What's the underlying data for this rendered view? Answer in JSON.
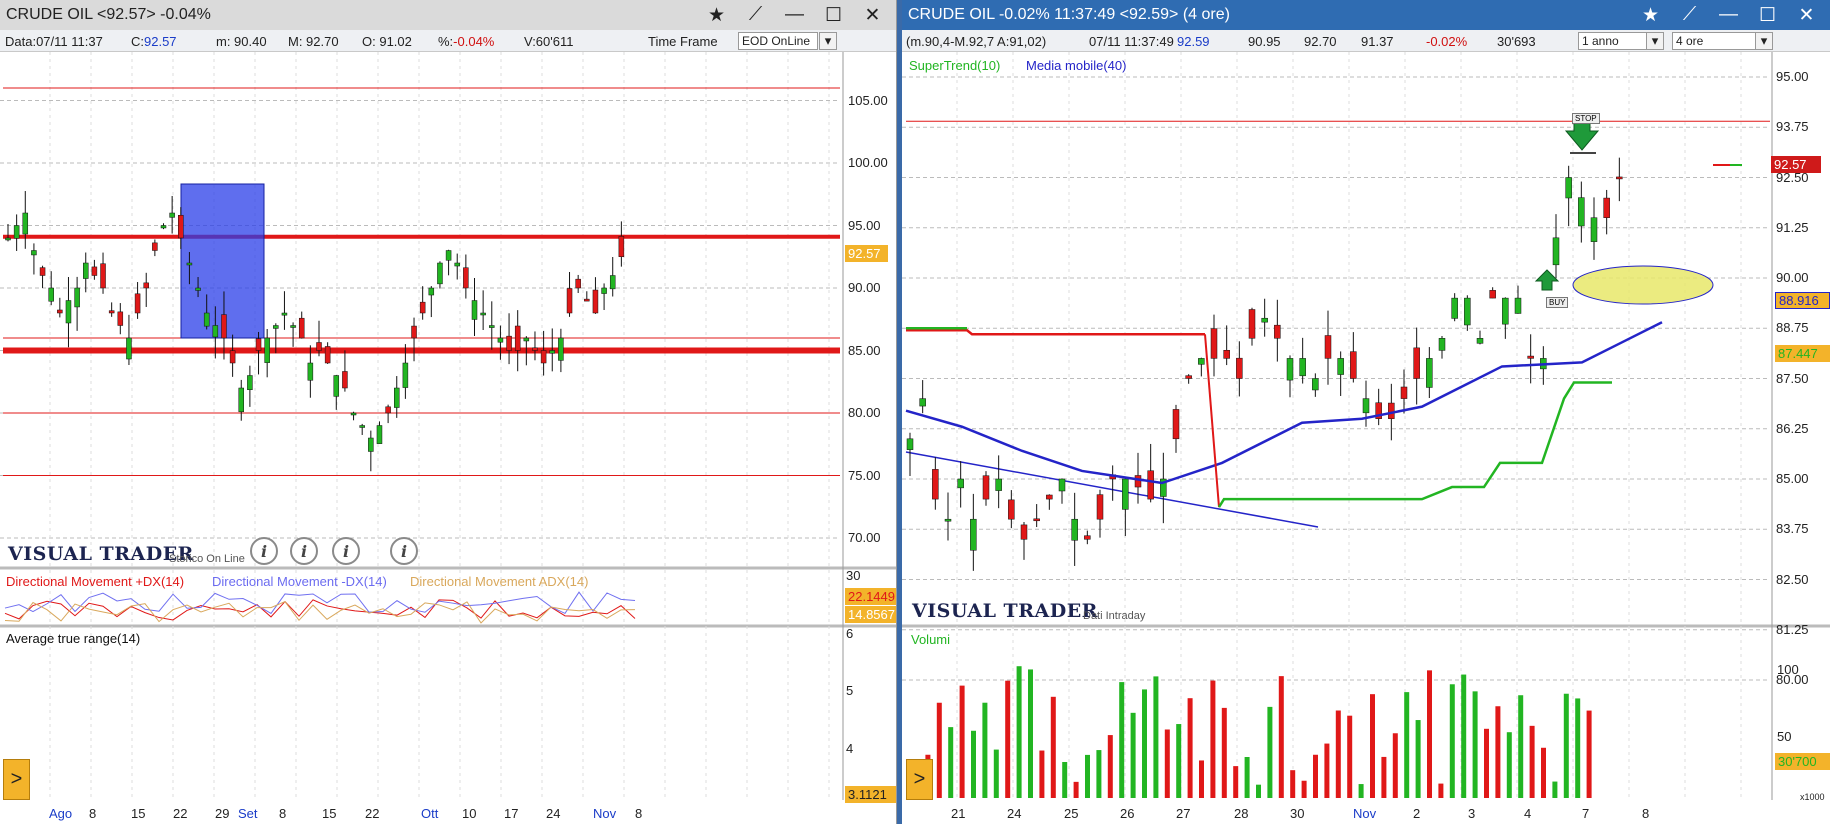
{
  "colors": {
    "up": "#22b522",
    "down": "#e01818",
    "title_left_bg": "#dadada",
    "title_right_bg": "#2f6cb2",
    "price_tag": "#f3b32a"
  },
  "left": {
    "title": "CRUDE OIL <92.57> -0.04%",
    "info": {
      "data": "Data:07/11 11:37",
      "close_label": "C:",
      "close": "92.57",
      "min": "m: 90.40",
      "max": "M: 92.70",
      "open": "O: 91.02",
      "pct_label": "%:",
      "pct": "-0.04%",
      "vol": "V:60'611"
    },
    "timeframe_label": "Time Frame",
    "timeframe_value": "EOD OnLine",
    "price_axis": [
      "105.00",
      "100.00",
      "95.00",
      "90.00",
      "85.00",
      "80.00",
      "75.00",
      "70.00"
    ],
    "last_price": "92.57",
    "brand": "VISUAL TRADER",
    "brand_sub": "Storico On Line",
    "info_icon": "i",
    "dmi": {
      "plus": "Directional Movement +DX(14)",
      "minus": "Directional Movement -DX(14)",
      "adx": "Directional Movement ADX(14)",
      "axis_top": "30",
      "v1": "22.1449",
      "v2": "14.8567"
    },
    "atr": {
      "label": "Average true range(14)",
      "axis": [
        "6",
        "5",
        "4"
      ],
      "value": "3.1121"
    },
    "dates": [
      "Ago",
      "8",
      "15",
      "22",
      "29",
      "Set",
      "8",
      "15",
      "22",
      "Ott",
      "10",
      "17",
      "24",
      "Nov",
      "8"
    ],
    "nav_arrow": ">"
  },
  "right": {
    "title": "CRUDE OIL -0.02% 11:37:49  <92.59> (4 ore)",
    "info": {
      "ohlc": "(m.90,4-M.92,7 A:91,02)",
      "time": "07/11 11:37:49",
      "last": "92.59",
      "v1": "90.95",
      "v2": "92.70",
      "v3": "91.37",
      "pct": "-0.02%",
      "vol": "30'693"
    },
    "range_value": "1 anno",
    "interval_value": "4 ore",
    "legend_supertrend": "SuperTrend(10)",
    "legend_ma": "Media mobile(40)",
    "price_axis": [
      "95.00",
      "93.75",
      "92.50",
      "91.25",
      "90.00",
      "88.75",
      "87.50",
      "86.25",
      "85.00",
      "83.75",
      "82.50",
      "81.25",
      "80.00"
    ],
    "tag_price": "92.57",
    "tag_ma": "88.916",
    "tag_st": "87.447",
    "stop_label": "STOP",
    "buy_label": "BUY",
    "brand": "VISUAL TRADER",
    "brand_sub": "Dati Intraday",
    "volume": {
      "label": "Volumi",
      "axis": [
        "100",
        "50"
      ],
      "value": "30'700",
      "scale": "x1000"
    },
    "dates": [
      "21",
      "24",
      "25",
      "26",
      "27",
      "28",
      "30",
      "Nov",
      "2",
      "3",
      "4",
      "7",
      "8"
    ],
    "nav_arrow": ">"
  }
}
